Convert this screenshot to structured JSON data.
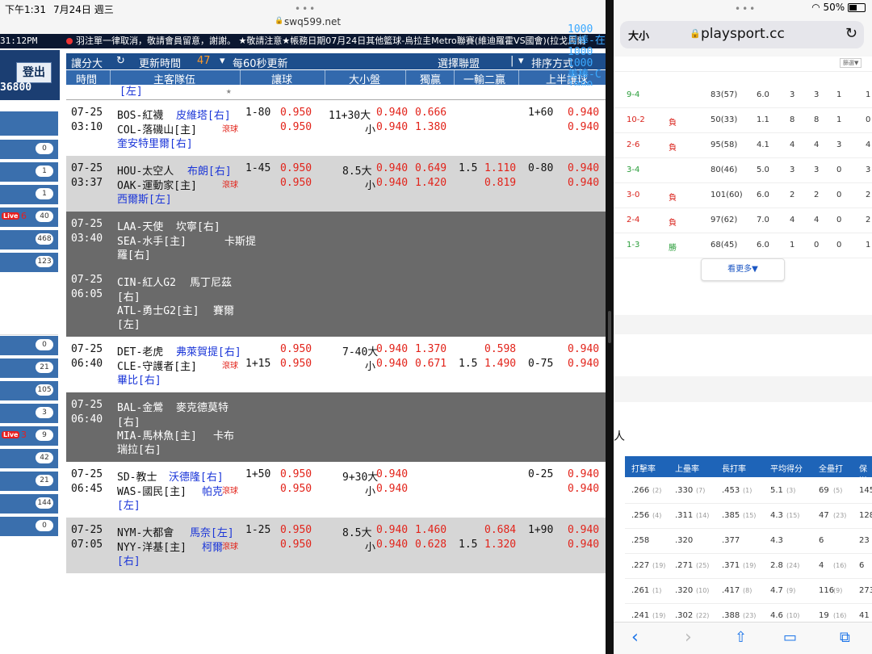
{
  "status": {
    "time": "下午1:31",
    "date": "7月24日 週三",
    "wifi": "",
    "battery": "50%"
  },
  "left_browser": {
    "url": "swq599.net"
  },
  "ticker": {
    "clock": "31:12PM",
    "text": "羽注單一律取消，敬請會員留意，謝謝。 ★敬請注意★帳務日期07月24日其他籃球-烏拉圭Metro聯賽(維迪羅霍VS國會)(拉戈馬爾"
  },
  "sidebar": {
    "logout": "登出",
    "balance": "36800",
    "rows": [
      {
        "count": "0"
      },
      {
        "count": "1"
      },
      {
        "count": "1"
      },
      {
        "live": "Live",
        "live_num": "6",
        "count": "40"
      },
      {
        "count": "468"
      },
      {
        "count": "123"
      },
      {
        "count": "0"
      },
      {
        "count": "21"
      },
      {
        "count": "105"
      },
      {
        "count": "3"
      },
      {
        "live": "Live",
        "live_num": "3",
        "count": "9"
      },
      {
        "count": "42"
      },
      {
        "count": "21"
      },
      {
        "count": "144"
      },
      {
        "count": "0"
      }
    ]
  },
  "toolbar": {
    "mode": "讓分大",
    "refresh_icon": "↻",
    "refresh": "更新時間",
    "countdown": "47",
    "auto": "每60秒更新",
    "league": "選擇聯盟",
    "sort": "排序方式"
  },
  "columns": {
    "time": "時間",
    "teams": "主客隊伍",
    "handicap": "讓球",
    "ou": "大小盤",
    "ml": "獨贏",
    "one_two": "一輸二贏",
    "half": "上半讓球"
  },
  "overflow_right": [
    "1000",
    "日棒-在",
    "1000",
    "1000",
    "美棒-C",
    "1000"
  ],
  "games": [
    {
      "date": "07-25",
      "time": "03:10",
      "away": "BOS-紅襪",
      "away_p": "皮維塔[右]",
      "home": "COL-落磯山[主]",
      "home_p": "奎安特里爾[右]",
      "live": "滾球",
      "hc": "1-80",
      "hc_a": "0.950",
      "hc_h": "0.950",
      "ou": "11+30大",
      "ou_a": "0.940",
      "ou_b": "小",
      "ou_h": "0.940",
      "ml_a": "0.666",
      "ml_h": "1.380",
      "one_two_line": "",
      "one_two_a": "",
      "one_two_h": "",
      "half_line": "1+60",
      "half_a": "0.940",
      "half_h": "0.940"
    },
    {
      "date": "07-25",
      "time": "03:37",
      "away": "HOU-太空人",
      "away_p": "布朗[右]",
      "home": "OAK-運動家[主]",
      "home_p": "西爾斯[左]",
      "live": "滾球",
      "hc": "1-45",
      "hc_a": "0.950",
      "hc_h": "0.950",
      "ou": "8.5大",
      "ou_a": "0.940",
      "ou_b": "小",
      "ou_h": "0.940",
      "ml_a": "0.649",
      "ml_h": "1.420",
      "one_two_line": "1.5",
      "one_two_a": "1.110",
      "one_two_h": "0.819",
      "half_line": "0-80",
      "half_a": "0.940",
      "half_h": "0.940"
    },
    {
      "date": "07-25",
      "time": "03:40",
      "away": "LAA-天使",
      "away_p": "坎寧[右]",
      "home": "SEA-水手[主]",
      "home_p": "卡斯提",
      "home_p2": "羅[右]"
    },
    {
      "date": "07-25",
      "time": "06:05",
      "away": "CIN-紅人G2",
      "away_p": "馬丁尼茲",
      "away_p2": "[右]",
      "home": "ATL-勇士G2[主]",
      "home_p": "賽爾",
      "home_p2": "[左]"
    },
    {
      "date": "07-25",
      "time": "06:40",
      "away": "DET-老虎",
      "away_p": "弗萊賀提[右]",
      "home": "CLE-守護者[主]",
      "home_p": "畢比[右]",
      "live": "滾球",
      "hc": "1+15",
      "hc_a": "0.950",
      "hc_h": "0.950",
      "ou": "7-40大",
      "ou_a": "0.940",
      "ou_b": "小",
      "ou_h": "0.940",
      "ml_a": "1.370",
      "ml_h": "0.671",
      "one_two_line": "1.5",
      "one_two_a": "0.598",
      "one_two_h": "1.490",
      "half_line": "0-75",
      "half_a": "0.940",
      "half_h": "0.940"
    },
    {
      "date": "07-25",
      "time": "06:40",
      "away": "BAL-金鶯",
      "away_p": "麥克德莫特",
      "away_p2": "[右]",
      "home": "MIA-馬林魚[主]",
      "home_p": "卡布",
      "home_p2": "瑞拉[右]"
    },
    {
      "date": "07-25",
      "time": "06:45",
      "away": "SD-教士",
      "away_p": "沃德隆[右]",
      "home": "WAS-國民[主]",
      "home_p": "帕克",
      "home_p2": "[左]",
      "live": "滾球",
      "hc": "1+50",
      "hc_a": "0.950",
      "hc_h": "0.950",
      "ou": "9+30大",
      "ou_a": "0.940",
      "ou_b": "小",
      "ou_h": "0.940",
      "half_line": "0-25",
      "half_a": "0.940",
      "half_h": "0.940"
    },
    {
      "date": "07-25",
      "time": "07:05",
      "away": "NYM-大都會",
      "away_p": "馬奈[左]",
      "home": "NYY-洋基[主]",
      "home_p": "柯爾",
      "home_p2": "[右]",
      "live": "滾球",
      "hc": "1-25",
      "hc_a": "0.950",
      "hc_h": "0.950",
      "ou": "8.5大",
      "ou_a": "0.940",
      "ou_b": "小",
      "ou_h": "0.940",
      "ml_a": "1.460",
      "ml_h": "0.628",
      "one_two_line": "1.5",
      "one_two_a": "0.684",
      "one_two_h": "1.320",
      "half_line": "1+90",
      "half_a": "0.940",
      "half_h": "0.940"
    }
  ],
  "right_browser": {
    "text_size": "大小",
    "host": "playsport.cc",
    "rows": [
      {
        "score": "9-4",
        "r": "",
        "n": "83(57)",
        "a": "6.0",
        "b": "3",
        "c": "3",
        "d": "1",
        "e": "1"
      },
      {
        "score": "10-2",
        "r": "負",
        "n": "50(33)",
        "a": "1.1",
        "b": "8",
        "c": "8",
        "d": "1",
        "e": "0"
      },
      {
        "score": "2-6",
        "r": "負",
        "n": "95(58)",
        "a": "4.1",
        "b": "4",
        "c": "4",
        "d": "3",
        "e": "4"
      },
      {
        "score": "3-4",
        "r": "",
        "n": "80(46)",
        "a": "5.0",
        "b": "3",
        "c": "3",
        "d": "0",
        "e": "3"
      },
      {
        "score": "3-0",
        "r": "負",
        "n": "101(60)",
        "a": "6.0",
        "b": "2",
        "c": "2",
        "d": "0",
        "e": "2"
      },
      {
        "score": "2-4",
        "r": "負",
        "n": "97(62)",
        "a": "7.0",
        "b": "4",
        "c": "4",
        "d": "0",
        "e": "2"
      },
      {
        "score": "1-3",
        "r": "勝",
        "n": "68(45)",
        "a": "6.0",
        "b": "1",
        "c": "0",
        "d": "0",
        "e": "1"
      }
    ],
    "more": "看更多▼",
    "filter": "篩選▼",
    "section_label": "人",
    "stat_head": [
      "打擊率",
      "上壘率",
      "長打率",
      "平均得分",
      "全壘打",
      "保送"
    ],
    "stats": [
      {
        "v": [
          ".266",
          "(2)",
          ".330",
          "(7)",
          ".453",
          "(1)",
          "5.1",
          "(3)",
          "69",
          "(5)",
          "145"
        ]
      },
      {
        "v": [
          ".256",
          "(4)",
          ".311",
          "(14)",
          ".385",
          "(15)",
          "4.3",
          "(15)",
          "47",
          "(23)",
          "128"
        ]
      },
      {
        "v": [
          ".258",
          "",
          ".320",
          "",
          ".377",
          "",
          "4.3",
          "",
          "6",
          "",
          "23"
        ]
      },
      {
        "v": [
          ".227",
          "(19)",
          ".271",
          "(25)",
          ".371",
          "(19)",
          "2.8",
          "(24)",
          "4",
          "(16)",
          "6"
        ]
      },
      {
        "v": [
          ".261",
          "(1)",
          ".320",
          "(10)",
          ".417",
          "(8)",
          "4.7",
          "(9)",
          "116",
          "(9)",
          "273"
        ]
      },
      {
        "v": [
          ".241",
          "(19)",
          ".302",
          "(22)",
          ".388",
          "(23)",
          "4.6",
          "(10)",
          "19",
          "(16)",
          "41"
        ]
      }
    ]
  }
}
